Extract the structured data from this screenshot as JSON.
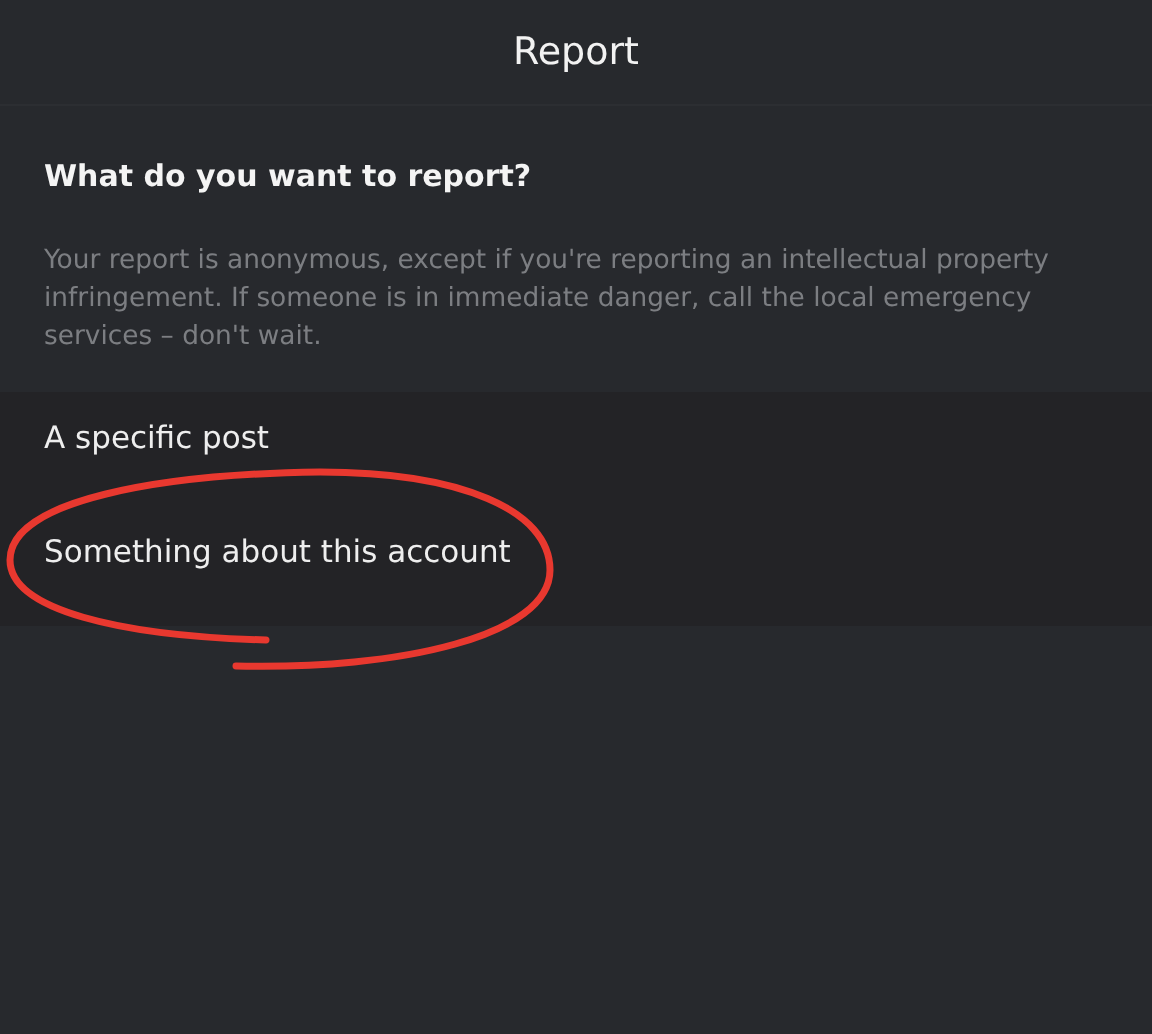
{
  "window": {
    "title": "Report"
  },
  "prompt": {
    "heading": "What do you want to report?",
    "note": "Your report is anonymous, except if you're reporting an intellectual property infringement. If someone is in immediate danger, call the local emergency services – don't wait."
  },
  "options": [
    {
      "label": "A specific post"
    },
    {
      "label": "Something about this account"
    }
  ],
  "annotation": {
    "color": "#e8382f"
  }
}
